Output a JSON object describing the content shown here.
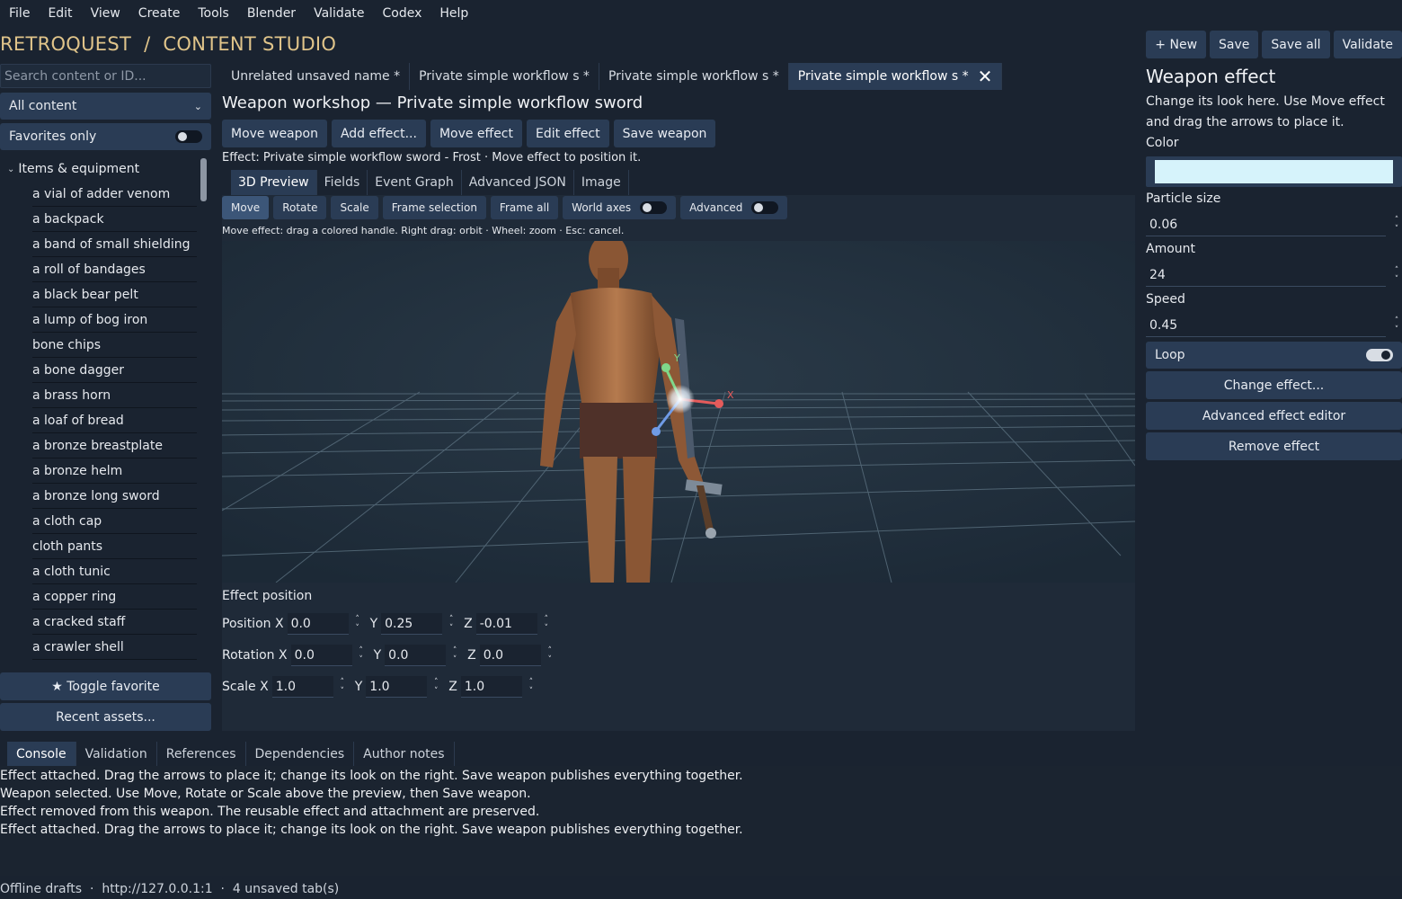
{
  "menu": [
    "File",
    "Edit",
    "View",
    "Create",
    "Tools",
    "Blender",
    "Validate",
    "Codex",
    "Help"
  ],
  "app_title": "RETROQUEST  /  CONTENT STUDIO",
  "top_actions": {
    "new": "+ New",
    "save": "Save",
    "save_all": "Save all",
    "validate": "Validate"
  },
  "left": {
    "search_placeholder": "Search content or ID...",
    "filter": "All content",
    "favorites_only": "Favorites only",
    "group": "Items & equipment",
    "items": [
      "a vial of adder venom",
      "a backpack",
      "a band of small shielding",
      "a roll of bandages",
      "a black bear pelt",
      "a lump of bog iron",
      "bone chips",
      "a bone dagger",
      "a brass horn",
      "a loaf of bread",
      "a bronze breastplate",
      "a bronze helm",
      "a bronze long sword",
      "a cloth cap",
      "cloth pants",
      "a cloth tunic",
      "a copper ring",
      "a cracked staff",
      "a crawler shell"
    ],
    "toggle_favorite": "★ Toggle favorite",
    "recent_assets": "Recent assets..."
  },
  "doc_tabs": [
    {
      "label": "Unrelated unsaved name *",
      "active": false
    },
    {
      "label": "Private simple workflow s *",
      "active": false
    },
    {
      "label": "Private simple workflow s *",
      "active": false
    },
    {
      "label": "Private simple workflow s *",
      "active": true
    }
  ],
  "workshop": {
    "title": "Weapon workshop — Private simple workflow sword",
    "actions": {
      "move_weapon": "Move weapon",
      "add_effect": "Add effect...",
      "move_effect": "Move effect",
      "edit_effect": "Edit effect",
      "save_weapon": "Save weapon"
    },
    "effect_line": "Effect: Private simple workflow sword - Frost · Move effect to position it.",
    "sub_tabs": [
      "3D Preview",
      "Fields",
      "Event Graph",
      "Advanced JSON",
      "Image"
    ],
    "toolbar": {
      "move": "Move",
      "rotate": "Rotate",
      "scale": "Scale",
      "frame_selection": "Frame selection",
      "frame_all": "Frame all",
      "world_axes": "World axes",
      "advanced": "Advanced"
    },
    "hint": "Move effect: drag a colored handle. Right drag: orbit · Wheel: zoom · Esc: cancel.",
    "gizmo": {
      "x": "X",
      "y": "Y"
    }
  },
  "transform": {
    "heading": "Effect position",
    "position": {
      "label": "Position X",
      "x": "0.0",
      "y": "0.25",
      "z": "-0.01"
    },
    "rotation": {
      "label": "Rotation X",
      "x": "0.0",
      "y": "0.0",
      "z": "0.0"
    },
    "scale": {
      "label": "Scale X",
      "x": "1.0",
      "y": "1.0",
      "z": "1.0"
    },
    "y_label": "Y",
    "z_label": "Z"
  },
  "right": {
    "title": "Weapon effect",
    "desc": "Change its look here. Use Move effect and drag the arrows to place it.",
    "color_label": "Color",
    "color_value": "#d6f3fb",
    "particle_size_label": "Particle size",
    "particle_size": "0.06",
    "amount_label": "Amount",
    "amount": "24",
    "speed_label": "Speed",
    "speed": "0.45",
    "loop": "Loop",
    "change_effect": "Change effect...",
    "advanced_editor": "Advanced effect editor",
    "remove_effect": "Remove effect"
  },
  "bottom_tabs": [
    "Console",
    "Validation",
    "References",
    "Dependencies",
    "Author notes"
  ],
  "console": [
    "Effect attached. Drag the arrows to place it; change its look on the right. Save weapon publishes everything together.",
    "Weapon selected. Use Move, Rotate or Scale above the preview, then Save weapon.",
    "Effect removed from this weapon. The reusable effect and attachment are preserved.",
    "Effect attached. Drag the arrows to place it; change its look on the right. Save weapon publishes everything together."
  ],
  "status": "Offline drafts  ·  http://127.0.0.1:1  ·  4 unsaved tab(s)"
}
